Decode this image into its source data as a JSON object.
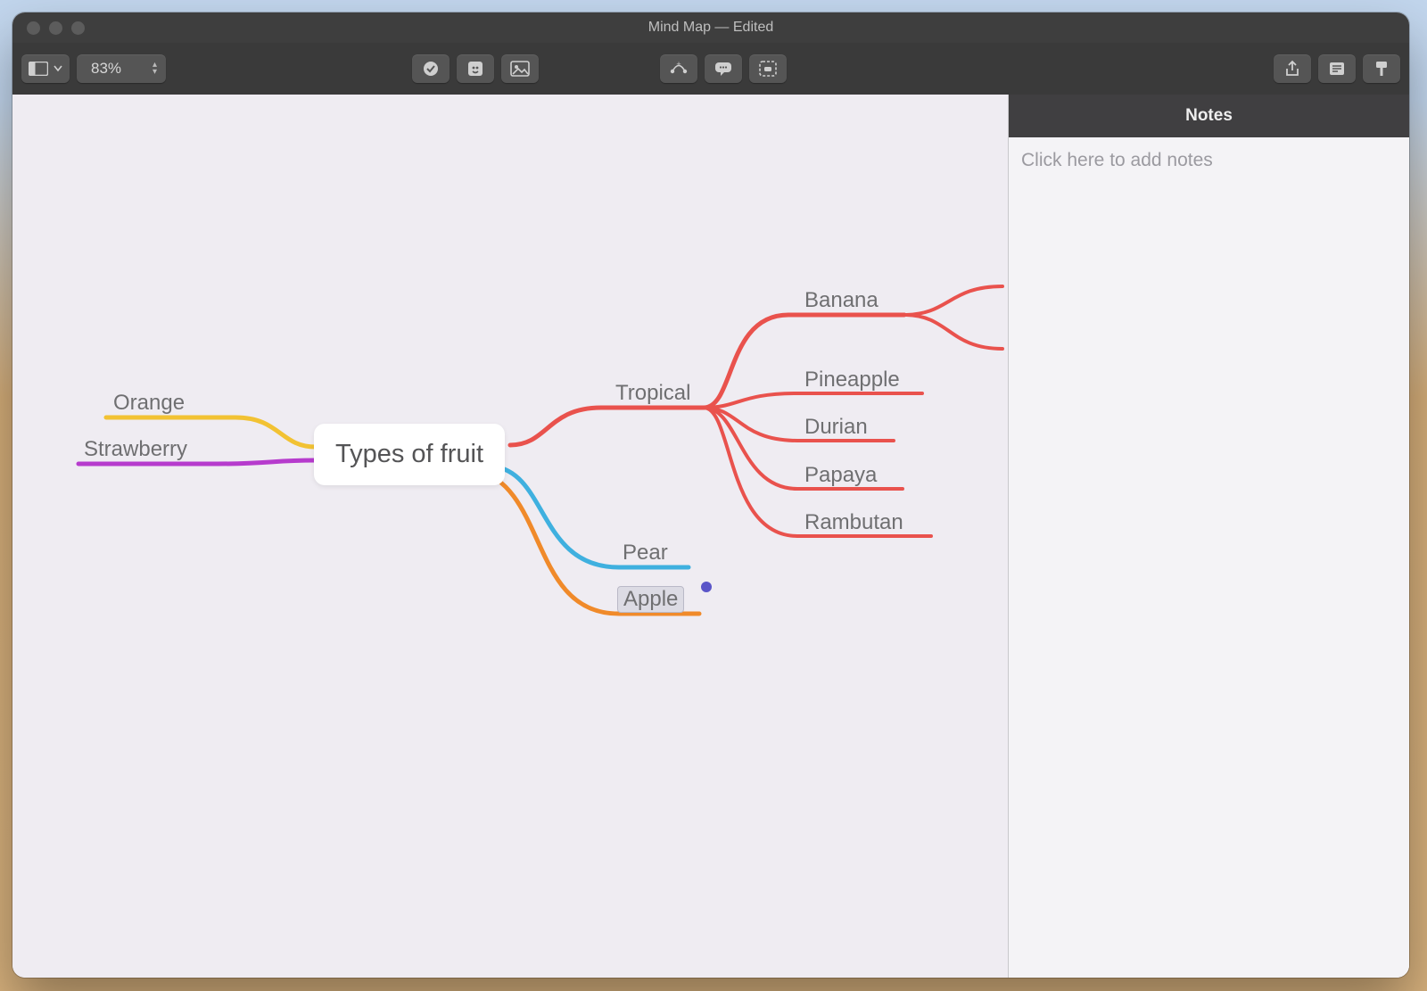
{
  "window": {
    "title": "Mind Map — Edited"
  },
  "toolbar": {
    "zoom": "83%"
  },
  "sidebar": {
    "title": "Notes",
    "placeholder": "Click here to add notes"
  },
  "mindmap": {
    "root": "Types of fruit",
    "left": [
      {
        "label": "Orange",
        "color": "#f2c233"
      },
      {
        "label": "Strawberry",
        "color": "#b63bcd"
      }
    ],
    "right": [
      {
        "label": "Tropical",
        "color": "#e9524d",
        "children": [
          {
            "label": "Banana"
          },
          {
            "label": "Pineapple"
          },
          {
            "label": "Durian"
          },
          {
            "label": "Papaya"
          },
          {
            "label": "Rambutan"
          }
        ]
      },
      {
        "label": "Pear",
        "color": "#3fb0df"
      },
      {
        "label": "Apple",
        "color": "#f08a2a",
        "selected": true,
        "has_note": true
      }
    ]
  },
  "colors": {
    "red": "#e9524d",
    "yellow": "#f2c233",
    "purple": "#b63bcd",
    "blue": "#3fb0df",
    "orange": "#f08a2a"
  }
}
